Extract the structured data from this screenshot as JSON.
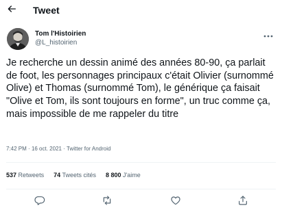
{
  "header": {
    "title": "Tweet"
  },
  "author": {
    "display_name": "Tom l'Histoirien",
    "handle": "@L_histoirien"
  },
  "tweet": {
    "text": "Je recherche un dessin animé des années 80-90, ça parlait de foot, les personnages principaux c'était Olivier (surnommé Olive) et Thomas (surnommé Tom), le générique ça faisait \"Olive et Tom, ils sont toujours en forme\", un truc comme ça, mais impossible de me rappeler du titre",
    "time": "7:42 PM",
    "separator": "·",
    "date": "16 oct. 2021",
    "source": "Twitter for Android"
  },
  "stats": {
    "retweets_count": "537",
    "retweets_label": "Retweets",
    "quotes_count": "74",
    "quotes_label": "Tweets cités",
    "likes_count": "8 800",
    "likes_label": "J'aime"
  },
  "icons": {
    "back": "arrow-left-icon",
    "more": "more-horizontal-icon",
    "reply": "reply-icon",
    "retweet": "retweet-icon",
    "like": "heart-icon",
    "share": "share-icon"
  },
  "colors": {
    "text": "#0f1419",
    "secondary": "#536471",
    "divider": "#eff3f4"
  }
}
